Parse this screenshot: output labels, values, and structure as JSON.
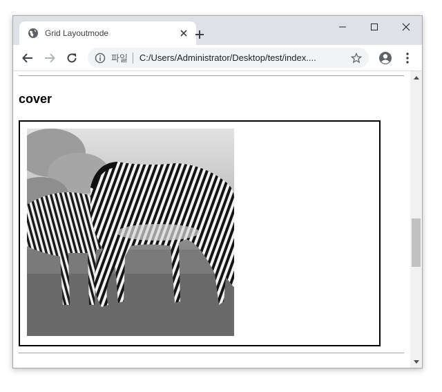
{
  "tab": {
    "title": "Grid Layoutmode",
    "favicon": "globe-icon",
    "close": "close-icon",
    "new_tab": "plus-icon"
  },
  "window_controls": {
    "minimize": "minimize-icon",
    "maximize": "maximize-icon",
    "close": "close-icon"
  },
  "toolbar": {
    "back": "arrow-left-icon",
    "forward": "arrow-right-icon",
    "reload": "reload-icon",
    "bookmark": "star-icon",
    "profile": "account-icon",
    "menu": "kebab-menu-icon"
  },
  "address": {
    "scheme_label": "파일",
    "url": "C:/Users/Administrator/Desktop/test/index...."
  },
  "page": {
    "heading": "cover",
    "image_alt": "grazing zebras photo"
  },
  "colors": {
    "tabstrip": "#dee1e6",
    "omnibox": "#f1f3f4",
    "scroll_thumb": "#c1c1c1"
  }
}
